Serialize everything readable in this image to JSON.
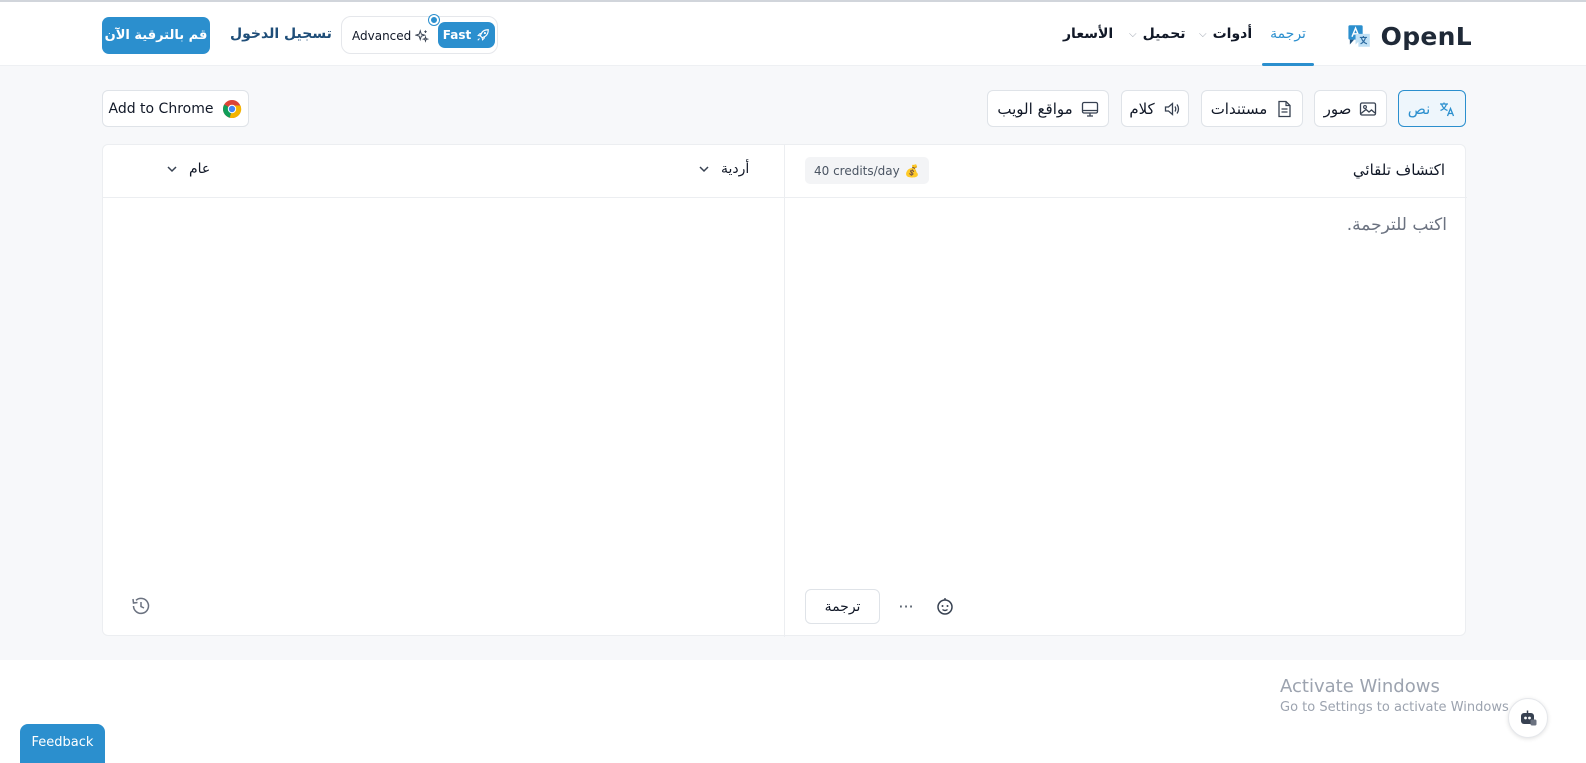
{
  "header": {
    "logo_text": "OpenL",
    "nav": {
      "translate": "ترجمة",
      "tools": "أدوات",
      "download": "تحميل",
      "pricing": "الأسعار"
    },
    "mode": {
      "advanced": "Advanced",
      "fast": "Fast",
      "selected": "Fast"
    },
    "login": "تسجيل الدخول",
    "upgrade": "قم بالترقية الآن"
  },
  "tabs": {
    "text": "نص",
    "images": "صور",
    "documents": "مستندات",
    "speech": "كلام",
    "websites": "مواقع الويب",
    "active": "text"
  },
  "add_to_chrome": "Add to Chrome",
  "source": {
    "language": "اكتشاف تلقائي",
    "credits": "40 credits/day",
    "placeholder": "اكتب للترجمة.",
    "value": ""
  },
  "target": {
    "language": "أردية",
    "style": "عام"
  },
  "actions": {
    "translate": "ترجمة",
    "more": "···"
  },
  "system": {
    "activate_title": "Activate Windows",
    "activate_sub": "Go to Settings to activate Windows.",
    "feedback": "Feedback"
  },
  "colors": {
    "accent": "#2b8fce",
    "background": "#f7f8fa"
  }
}
